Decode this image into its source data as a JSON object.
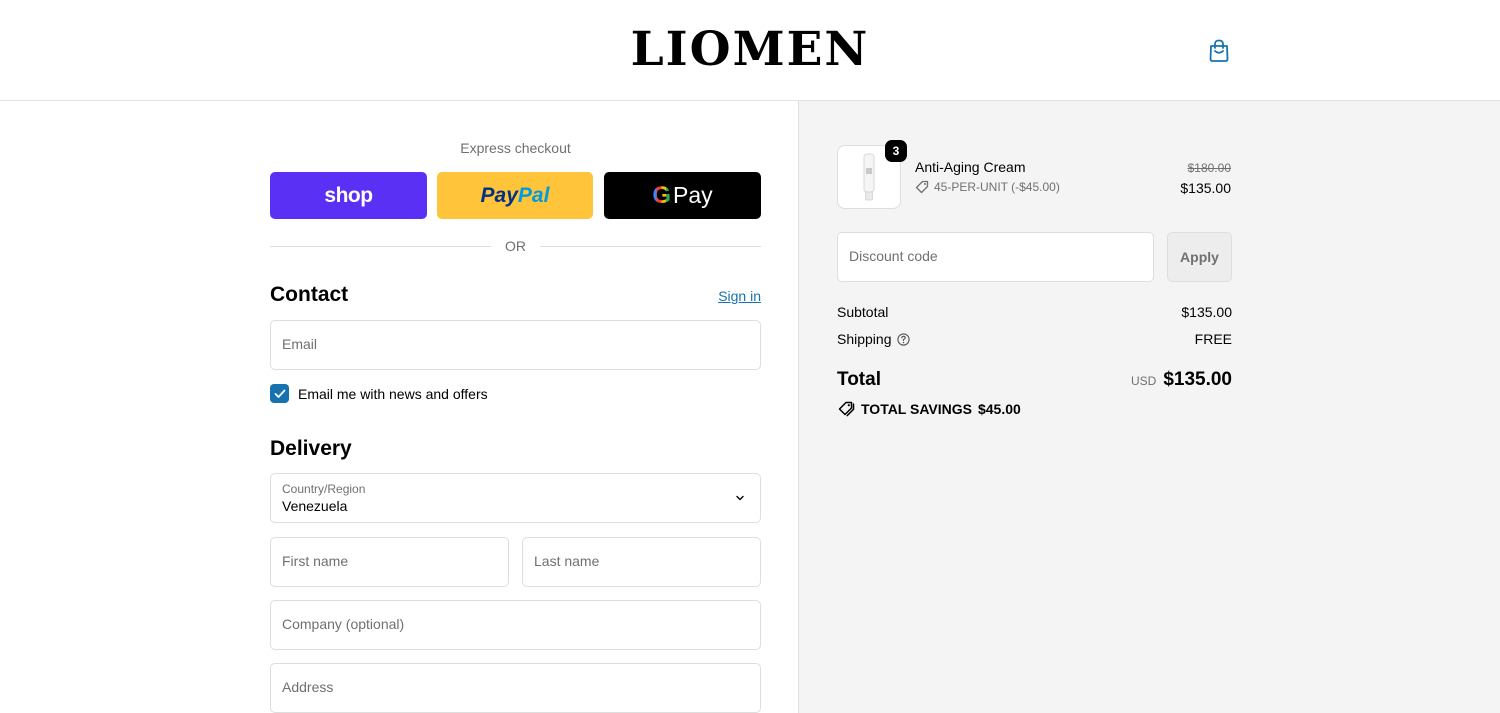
{
  "header": {
    "logo": "LIOMEN",
    "cart_icon": "shopping-bag-icon"
  },
  "express": {
    "title": "Express checkout",
    "shop_label": "shop",
    "paypal_part1": "Pay",
    "paypal_part2": "Pal",
    "gpay_g": "G",
    "gpay_label": "Pay",
    "or": "OR"
  },
  "contact": {
    "title": "Contact",
    "signin": "Sign in",
    "email_placeholder": "Email",
    "news_label": "Email me with news and offers",
    "news_checked": true
  },
  "delivery": {
    "title": "Delivery",
    "country_label": "Country/Region",
    "country_value": "Venezuela",
    "first_name_placeholder": "First name",
    "last_name_placeholder": "Last name",
    "company_placeholder": "Company (optional)",
    "address_placeholder": "Address"
  },
  "summary": {
    "product": {
      "name": "Anti-Aging Cream",
      "quantity": "3",
      "discount": "45-PER-UNIT (-$45.00)",
      "old_price": "$180.00",
      "price": "$135.00"
    },
    "discount_placeholder": "Discount code",
    "apply_label": "Apply",
    "subtotal_label": "Subtotal",
    "subtotal_value": "$135.00",
    "shipping_label": "Shipping",
    "shipping_value": "FREE",
    "total_label": "Total",
    "currency": "USD",
    "total_value": "$135.00",
    "savings_label": "TOTAL SAVINGS",
    "savings_value": "$45.00"
  },
  "colors": {
    "shop": "#5a31f4",
    "paypal": "#ffc439",
    "gpay": "#000000",
    "link": "#1773b0",
    "summary_bg": "#f4f4f4"
  }
}
